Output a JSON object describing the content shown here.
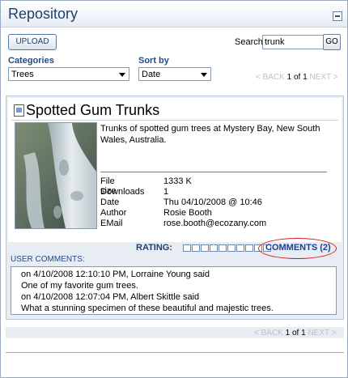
{
  "header": {
    "title": "Repository"
  },
  "toolbar": {
    "upload_label": "UPLOAD",
    "search_label": "Search",
    "search_value": "trunk",
    "go_label": "GO"
  },
  "filters": {
    "categories_label": "Categories",
    "categories_value": "Trees",
    "sort_label": "Sort by",
    "sort_value": "Date"
  },
  "pager": {
    "back": "< BACK",
    "page": "1",
    "of_text": "of",
    "total": "1",
    "next": "NEXT >"
  },
  "item": {
    "title": "Spotted Gum Trunks",
    "description": "Trunks of spotted gum trees at Mystery Bay, New South Wales, Australia.",
    "meta": [
      {
        "key": "File size",
        "value": "1333 K"
      },
      {
        "key": "Downloads",
        "value": "1"
      },
      {
        "key": "Date",
        "value": "Thu 04/10/2008 @ 10:46"
      },
      {
        "key": "Author",
        "value": "Rosie Booth"
      },
      {
        "key": "EMail",
        "value": "rose.booth@ecozany.com"
      }
    ],
    "rating_label": "RATING:",
    "rating_value": 0,
    "rating_max": 10,
    "comments_link": "COMMENTS (2)"
  },
  "user_comments": {
    "label": "USER COMMENTS:",
    "entries": [
      {
        "header": "on 4/10/2008 12:10:10 PM, Lorraine Young said",
        "text": "One of my favorite gum trees."
      },
      {
        "header": "on 4/10/2008 12:07:04 PM, Albert Skittle said",
        "text": "What a stunning specimen of these beautiful and majestic trees."
      }
    ]
  },
  "colors": {
    "accent": "#1f4a8a",
    "highlight_ring": "#d21f1f"
  }
}
